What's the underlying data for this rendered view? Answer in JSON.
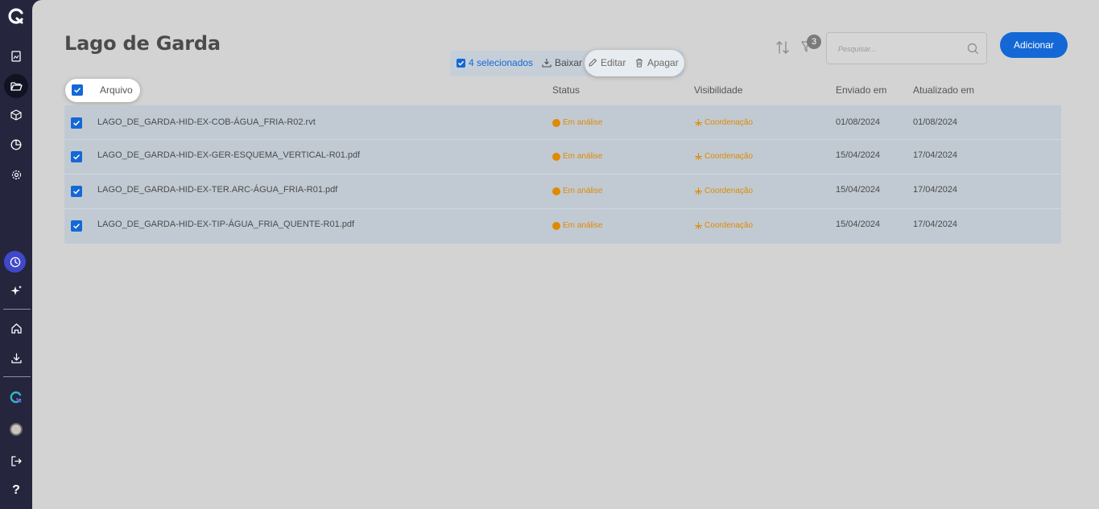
{
  "sidebar": {
    "logo_icon": "brand-logo-icon",
    "items": [
      {
        "name": "document-icon"
      },
      {
        "name": "folder-open-icon"
      },
      {
        "name": "cube-icon"
      },
      {
        "name": "pie-chart-icon"
      },
      {
        "name": "gear-icon"
      },
      {
        "name": "clock-icon"
      },
      {
        "name": "sparkle-icon"
      },
      {
        "name": "home-icon"
      },
      {
        "name": "download-icon"
      },
      {
        "name": "brand-logo-small-icon"
      },
      {
        "name": "avatar"
      },
      {
        "name": "logout-icon"
      }
    ],
    "help_label": "?"
  },
  "page": {
    "title": "Lago de Garda"
  },
  "toolbar": {
    "selected_label": "4 selecionados",
    "download_label": "Baixar",
    "edit_label": "Editar",
    "delete_label": "Apagar"
  },
  "header": {
    "filter_count": "3",
    "search_placeholder": "Pesquisar...",
    "add_label": "Adicionar"
  },
  "table": {
    "columns": {
      "file": "Arquivo",
      "status": "Status",
      "visibility": "Visibilidade",
      "sent": "Enviado em",
      "updated": "Atualizado em"
    },
    "rows": [
      {
        "file": "LAGO_DE_GARDA-HID-EX-COB-ÁGUA_FRIA-R02.rvt",
        "status": "Em análise",
        "visibility": "Coordenação",
        "sent": "01/08/2024",
        "updated": "01/08/2024"
      },
      {
        "file": "LAGO_DE_GARDA-HID-EX-GER-ESQUEMA_VERTICAL-R01.pdf",
        "status": "Em análise",
        "visibility": "Coordenação",
        "sent": "15/04/2024",
        "updated": "17/04/2024"
      },
      {
        "file": "LAGO_DE_GARDA-HID-EX-TER.ARC-ÁGUA_FRIA-R01.pdf",
        "status": "Em análise",
        "visibility": "Coordenação",
        "sent": "15/04/2024",
        "updated": "17/04/2024"
      },
      {
        "file": "LAGO_DE_GARDA-HID-EX-TIP-ÁGUA_FRIA_QUENTE-R01.pdf",
        "status": "Em análise",
        "visibility": "Coordenação",
        "sent": "15/04/2024",
        "updated": "17/04/2024"
      }
    ]
  },
  "colors": {
    "accent": "#1468d6",
    "status_orange": "#e08a00",
    "sidebar": "#25263d",
    "background": "#d3d3d3"
  }
}
